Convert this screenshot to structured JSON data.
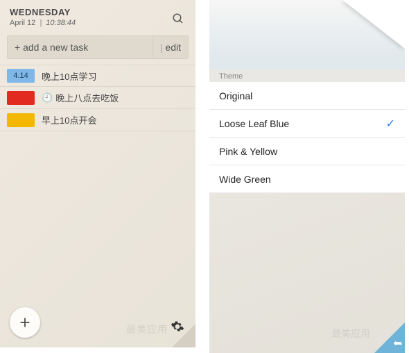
{
  "left": {
    "day": "WEDNESDAY",
    "date": "April 12",
    "time": "10:38:44",
    "search_icon": "search",
    "add_task_label": "+ add a new task",
    "edit_label": "edit",
    "tasks": [
      {
        "tag_text": "4.14",
        "tag_color": "blue",
        "text": "晚上10点学习",
        "has_clock": false
      },
      {
        "tag_text": "",
        "tag_color": "red",
        "text": "晚上八点去吃饭",
        "has_clock": true
      },
      {
        "tag_text": "",
        "tag_color": "yellow",
        "text": "早上10点开会",
        "has_clock": false
      }
    ],
    "fab_label": "+",
    "watermark": "最美应用"
  },
  "right": {
    "section_label": "Theme",
    "options": [
      {
        "label": "Original",
        "selected": false
      },
      {
        "label": "Loose Leaf Blue",
        "selected": true
      },
      {
        "label": "Pink & Yellow",
        "selected": false
      },
      {
        "label": "Wide Green",
        "selected": false
      }
    ],
    "watermark": "最美应用"
  }
}
